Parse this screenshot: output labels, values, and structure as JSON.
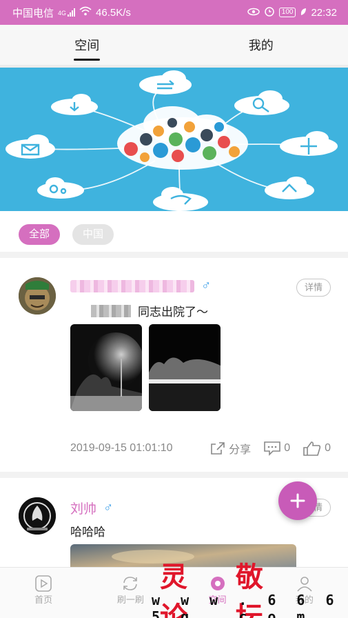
{
  "status_bar": {
    "carrier": "中国电信",
    "network": "4G",
    "speed": "46.5K/s",
    "battery": "100",
    "time": "22:32"
  },
  "tabs": [
    {
      "label": "空间",
      "active": true
    },
    {
      "label": "我的",
      "active": false
    }
  ],
  "filters": [
    {
      "label": "全部",
      "active": true
    },
    {
      "label": "中国",
      "active": false
    }
  ],
  "posts": [
    {
      "gender_icon": "male-icon",
      "detail_label": "详情",
      "content": "同志出院了～",
      "timestamp": "2019-09-15 01:01:10",
      "share_label": "分享",
      "comments": "0",
      "likes": "0"
    },
    {
      "username": "刘帅",
      "gender_icon": "male-icon",
      "detail_label": "详情",
      "content": "哈哈哈"
    }
  ],
  "bottom_nav": [
    {
      "label": "首页",
      "icon": "home-play-icon"
    },
    {
      "label": "刷一刷",
      "icon": "refresh-icon"
    },
    {
      "label": "空间",
      "icon": "space-icon",
      "active": true
    },
    {
      "label": "我的",
      "icon": "profile-icon"
    }
  ],
  "watermark": {
    "title": "灵 敬 论 坛",
    "site": "w w w . 6 6 6 5 q . c o m"
  },
  "colors": {
    "accent": "#d56fbf",
    "banner": "#3fb3de",
    "male": "#3fa0e8"
  }
}
